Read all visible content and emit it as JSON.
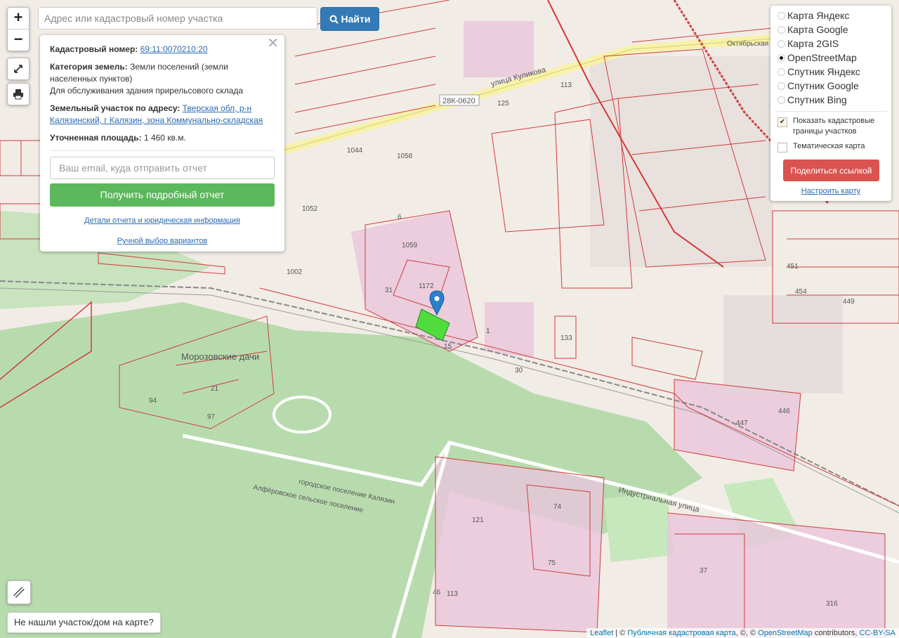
{
  "search": {
    "placeholder": "Адрес или кадастровый номер участка",
    "button_label": "Найти"
  },
  "zoom": {
    "in": "+",
    "out": "−"
  },
  "info": {
    "cad_label": "Кадастровый номер:",
    "cad_value": "69:11:0070210:20",
    "cat_label": "Категория земель:",
    "cat_value": "Земли поселений (земли населенных пунктов)",
    "use": "Для обслуживания здания прирельсового склада",
    "addr_label": "Земельный участок по адресу:",
    "addr_value": "Тверская обл, р-н Калязинский, г Калязин, зона Коммунально-складская",
    "area_label": "Уточненная площадь:",
    "area_value": "1 460 кв.м.",
    "email_placeholder": "Ваш email, куда отправить отчет",
    "report_button": "Получить подробный отчет",
    "details_link": "Детали отчета и юридическая информация",
    "manual_link": "Ручной выбор вариантов"
  },
  "layers": {
    "options": [
      {
        "label": "Карта Яндекс",
        "selected": false
      },
      {
        "label": "Карта Google",
        "selected": false
      },
      {
        "label": "Карта 2GIS",
        "selected": false
      },
      {
        "label": "OpenStreetMap",
        "selected": true
      },
      {
        "label": "Спутник Яндекс",
        "selected": false
      },
      {
        "label": "Спутник Google",
        "selected": false
      },
      {
        "label": "Спутник Bing",
        "selected": false
      }
    ],
    "show_borders": "Показать кадастровые границы участков",
    "show_borders_checked": true,
    "thematic": "Тематическая карта",
    "thematic_checked": false,
    "share_button": "Поделиться ссылкой",
    "configure_link": "Настроить карту"
  },
  "not_found_button": "Не нашли участок/дом на карте?",
  "attribution": {
    "leaflet": "Leaflet",
    "sep": " | © ",
    "pkk": "Публичная кадастровая карта",
    "mid": ", ©, © ",
    "osm": "OpenStreetMap",
    "contrib": " contributors, ",
    "license": "CC-BY-SA"
  },
  "map_labels": {
    "street_kulikova": "улица Куликова",
    "road_28k": "28К-0620",
    "street_oktyabrskaya": "Октябрьская",
    "street_industrial": "Индустриальная улица",
    "morozovskie": "Морозовские дачи",
    "border1": "городское поселение Калязин",
    "border2": "Алфёровское сельское поселение",
    "parcels": [
      "1172",
      "1059",
      "1058",
      "1044",
      "1052",
      "1002",
      "30",
      "133",
      "447",
      "121",
      "74",
      "75",
      "37",
      "316",
      "113",
      "46",
      "21",
      "97",
      "94",
      "449",
      "454",
      "451",
      "446",
      "125",
      "113",
      "6",
      "1",
      "15",
      "31"
    ]
  }
}
